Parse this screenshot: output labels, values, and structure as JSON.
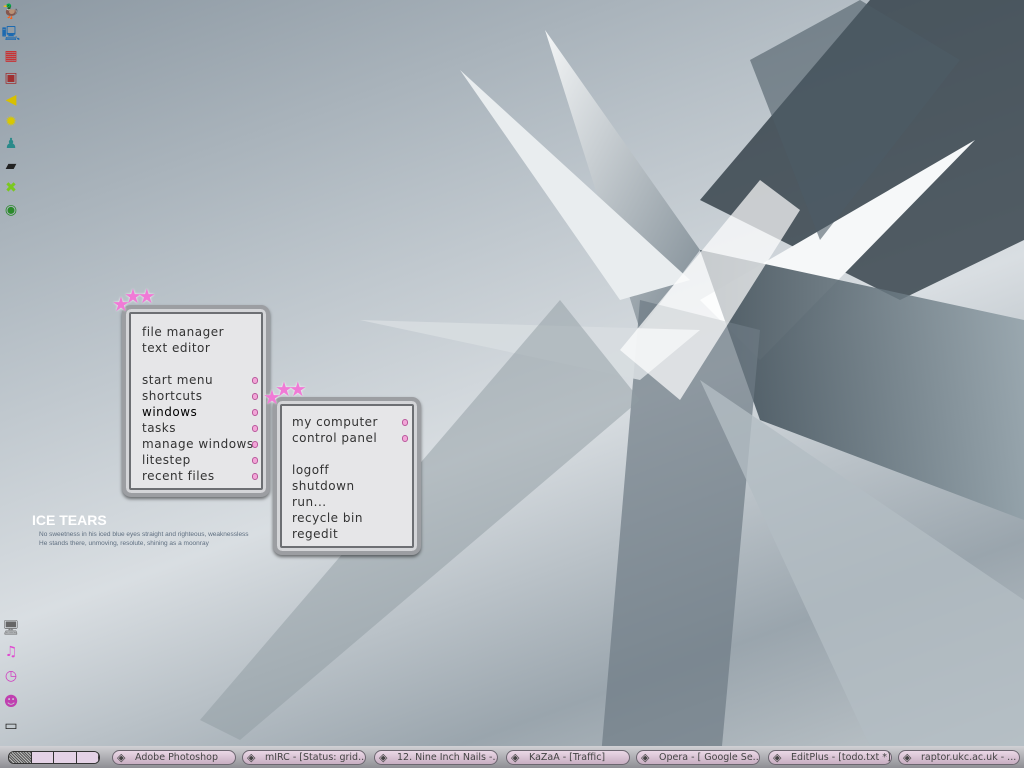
{
  "desktop_icons_top": [
    "rubber-duck-icon",
    "network-computer-icon",
    "control-panel-icon",
    "paint-icon",
    "volume-icon",
    "sun-flower-icon",
    "user-icon",
    "memory-chip-icon",
    "kazaa-icon",
    "browser-globe-icon"
  ],
  "desktop_icons_bottom": [
    "computer-icon",
    "music-note-icon",
    "clock-icon",
    "tamagotchi-icon",
    "terminal-icon"
  ],
  "main_menu": {
    "items": [
      {
        "label": "file manager",
        "sub": false
      },
      {
        "label": "text editor",
        "sub": false
      },
      {
        "label": "",
        "sub": false
      },
      {
        "label": "start menu",
        "sub": true
      },
      {
        "label": "shortcuts",
        "sub": true
      },
      {
        "label": "windows",
        "sub": true,
        "highlighted": true
      },
      {
        "label": "tasks",
        "sub": true
      },
      {
        "label": "manage windows",
        "sub": true
      },
      {
        "label": "litestep",
        "sub": true
      },
      {
        "label": "recent files",
        "sub": true
      }
    ]
  },
  "windows_menu": {
    "items": [
      {
        "label": "my computer",
        "sub": true
      },
      {
        "label": "control panel",
        "sub": true
      },
      {
        "label": "",
        "sub": false
      },
      {
        "label": "logoff",
        "sub": false
      },
      {
        "label": "shutdown",
        "sub": false
      },
      {
        "label": "run...",
        "sub": false
      },
      {
        "label": "recycle bin",
        "sub": false
      },
      {
        "label": "regedit",
        "sub": false
      }
    ]
  },
  "theme": {
    "title": "ICE TEARS",
    "line1": "No sweetness in his iced blue eyes straight and righteous, weaknessless",
    "line2": "He stands there, unmoving, resolute, shining as a moonray"
  },
  "taskbar": {
    "pager_desktops": 4,
    "current_desktop": 1,
    "tasks": [
      {
        "label": "Adobe Photoshop",
        "icon": "photoshop-icon"
      },
      {
        "label": "mIRC - [Status: grid...",
        "icon": "mirc-icon"
      },
      {
        "label": "12. Nine Inch Nails -...",
        "icon": "winamp-icon"
      },
      {
        "label": "KaZaA - [Traffic]",
        "icon": "kazaa-icon"
      },
      {
        "label": "Opera - [ Google Se...",
        "icon": "opera-icon"
      },
      {
        "label": "EditPlus - [todo.txt *]",
        "icon": "editplus-icon"
      },
      {
        "label": "raptor.ukc.ac.uk - ...",
        "icon": "terminal-icon"
      }
    ]
  },
  "colors": {
    "accent": "#f07ad6"
  }
}
